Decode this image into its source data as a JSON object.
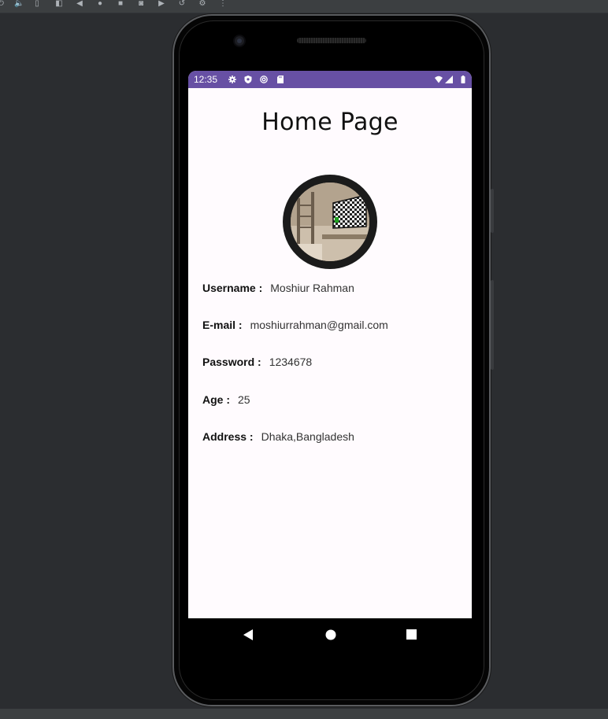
{
  "status_bar": {
    "time": "12:35",
    "left_icons": [
      "gear-icon",
      "shield-icon",
      "at-sign-icon",
      "sd-card-icon"
    ],
    "right_icons": [
      "wifi-icon",
      "signal-icon",
      "battery-icon"
    ],
    "color": "#6750a4"
  },
  "page": {
    "title": "Home Page"
  },
  "profile": {
    "fields": [
      {
        "label": "Username :",
        "value": "Moshiur Rahman"
      },
      {
        "label": "E-mail :",
        "value": "moshiurrahman@gmail.com"
      },
      {
        "label": "Password :",
        "value": "1234678"
      },
      {
        "label": "Age :",
        "value": "25"
      },
      {
        "label": "Address :",
        "value": "Dhaka,Bangladesh"
      }
    ]
  },
  "nav": {
    "buttons": [
      "back-icon",
      "home-icon",
      "recents-icon"
    ]
  }
}
